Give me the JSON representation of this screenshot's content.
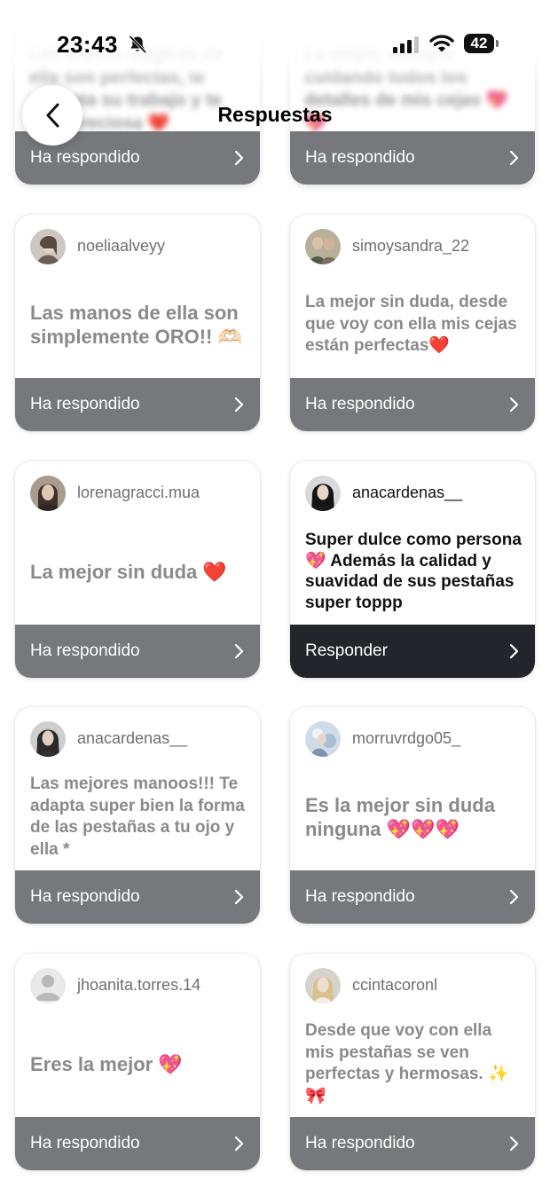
{
  "status_bar": {
    "time": "23:43",
    "battery": "42"
  },
  "header": {
    "title": "Respuestas"
  },
  "peek": [
    {
      "text": "Las manos mágicas de ella son perfectas, te encanta su trabajo y te deja preciosa ❤️",
      "footer_label": "Ha respondido"
    },
    {
      "text": "La mejor, siempre cuidando todos los detalles de mis cejas 💖💖",
      "footer_label": "Ha respondido"
    }
  ],
  "cards": [
    {
      "username": "noeliaalveyy",
      "message": "Las manos de ella son simplemente ORO!! 🫶🏻",
      "footer_label": "Ha respondido"
    },
    {
      "username": "simoysandra_22",
      "message": "La mejor sin duda, desde que voy con ella mis cejas están perfectas❤️",
      "footer_label": "Ha respondido"
    },
    {
      "username": "lorenagracci.mua",
      "message": "La mejor sin duda ❤️",
      "footer_label": "Ha respondido"
    },
    {
      "username": "anacardenas__",
      "message": "Super dulce como persona💖 Además la calidad y suavidad de sus pestañas super toppp",
      "footer_label": "Responder"
    },
    {
      "username": "anacardenas__",
      "message": "Las mejores manoos!!! Te adapta super bien la forma de las pestañas a tu ojo y ella *",
      "footer_label": "Ha respondido"
    },
    {
      "username": "morruvrdgo05_",
      "message": "Es la mejor sin duda ninguna 💖💖💖",
      "footer_label": "Ha respondido"
    },
    {
      "username": "jhoanita.torres.14",
      "message": "Eres la mejor 💖",
      "footer_label": "Ha respondido"
    },
    {
      "username": "ccintacoronl",
      "message": "Desde que voy con ella mis pestañas se ven perfectas y hermosas. ✨🎀",
      "footer_label": "Ha respondido"
    }
  ],
  "colors": {
    "replied_footer": "#77787c",
    "respond_footer": "#23252b",
    "muted_text": "#8a8a8a"
  },
  "icons": [
    "back-chevron-icon",
    "bell-slash-icon",
    "signal-icon",
    "wifi-icon",
    "battery-icon",
    "chevron-right-icon",
    "default-avatar-icon"
  ]
}
